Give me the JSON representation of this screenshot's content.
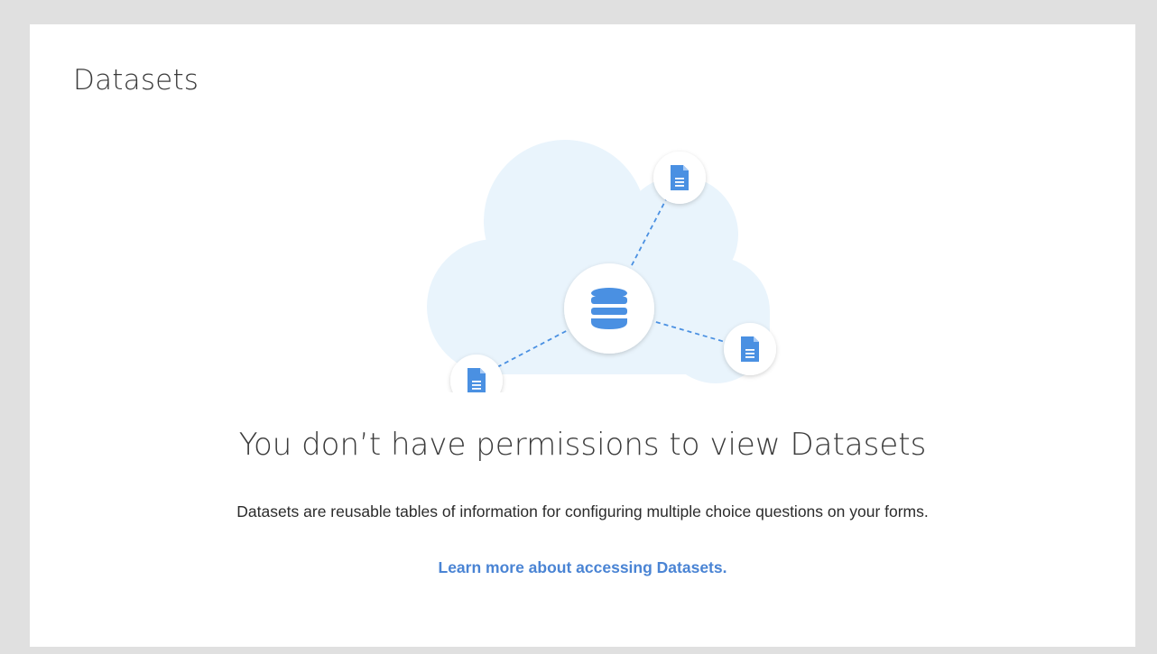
{
  "page": {
    "title": "Datasets"
  },
  "empty_state": {
    "illustration": {
      "center_icon": "database-icon",
      "node_icons": [
        "document-icon",
        "document-icon",
        "document-icon"
      ],
      "cloud_color": "#e9f4fc",
      "accent_color": "#4a90e2"
    },
    "headline": "You don’t have permissions to view Datasets",
    "description": "Datasets are reusable tables of information for configuring multiple choice questions on your forms.",
    "link_label": "Learn more about accessing Datasets."
  },
  "colors": {
    "background": "#e0e0e0",
    "card": "#ffffff",
    "link": "#4a84d4",
    "text": "#2b2b2b"
  }
}
